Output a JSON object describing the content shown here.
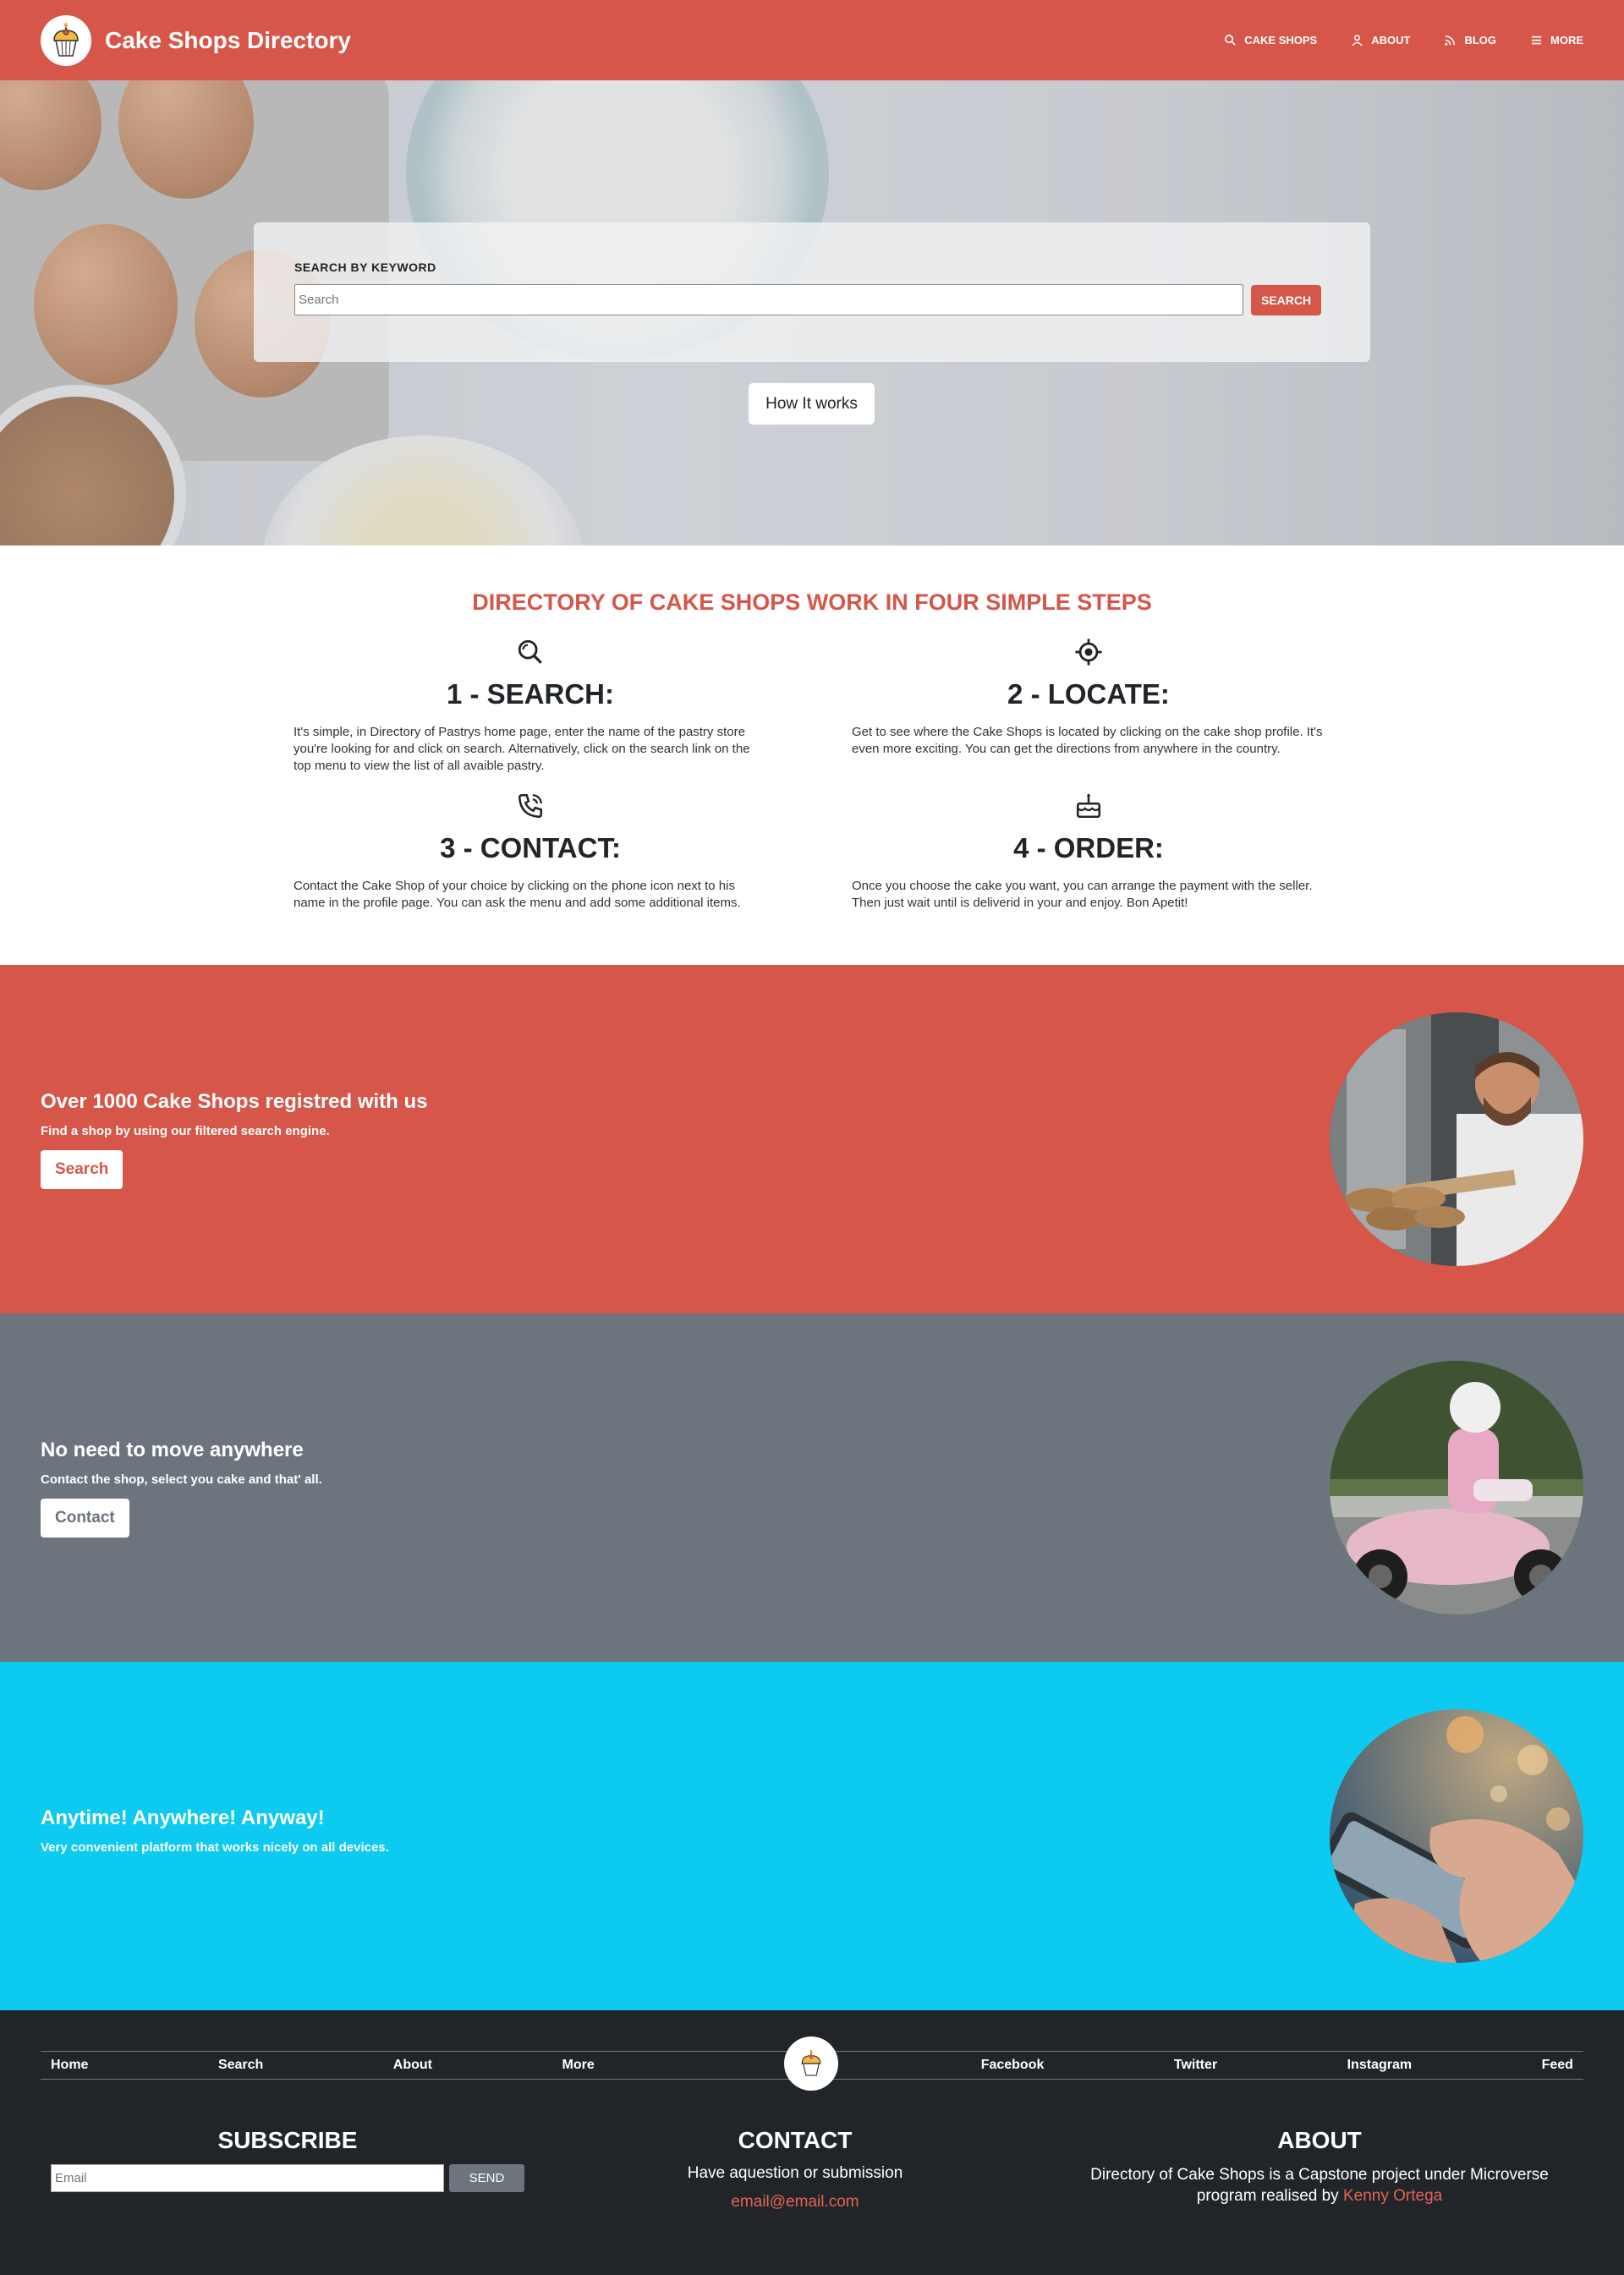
{
  "nav": {
    "brand": "Cake Shops Directory",
    "links": [
      {
        "label": "CAKE SHOPS",
        "icon": "search-icon"
      },
      {
        "label": "ABOUT",
        "icon": "user-icon"
      },
      {
        "label": "BLOG",
        "icon": "rss-icon"
      },
      {
        "label": "MORE",
        "icon": "menu-icon"
      }
    ]
  },
  "hero": {
    "search_heading": "SEARCH BY KEYWORD",
    "search_placeholder": "Search",
    "search_button": "SEARCH",
    "how_button": "How It works"
  },
  "steps": {
    "title": "DIRECTORY OF CAKE SHOPS WORK IN FOUR SIMPLE STEPS",
    "items": [
      {
        "heading": "1 - SEARCH:",
        "icon": "search-icon",
        "text": "It's simple, in Directory of Pastrys home page, enter the name of the pastry store you're looking for and click on search. Alternatively, click on the search link on the top menu to view the list of all avaible pastry."
      },
      {
        "heading": "2 - LOCATE:",
        "icon": "target-icon",
        "text": "Get to see where the Cake Shops is located by clicking on the cake shop profile. It's even more exciting. You can get the directions from anywhere in the country."
      },
      {
        "heading": "3 - CONTACT:",
        "icon": "phone-icon",
        "text": "Contact the Cake Shop of your choice by clicking on the phone icon next to his name in the profile page. You can ask the menu and add some additional items."
      },
      {
        "heading": "4 - ORDER:",
        "icon": "cake-icon",
        "text": "Once you choose the cake you want, you can arrange the payment with the seller. Then just wait until is deliverid in your and enjoy. Bon Apetit!"
      }
    ]
  },
  "features": [
    {
      "title": "Over 1000 Cake Shops registred with us",
      "subtitle": "Find a shop by using our filtered search engine.",
      "button": "Search",
      "color": "#d65649",
      "image": "baker-photo"
    },
    {
      "title": "No need to move anywhere",
      "subtitle": "Contact the shop, select you cake and that' all.",
      "button": "Contact",
      "color": "#6c757d",
      "image": "scooter-delivery-photo"
    },
    {
      "title": "Anytime! Anywhere! Anyway!",
      "subtitle": "Very convenient platform that works nicely on all devices.",
      "button": "",
      "color": "#0dcaf0",
      "image": "phone-hand-photo"
    }
  ],
  "footer": {
    "nav_left": [
      "Home",
      "Search",
      "About",
      "More"
    ],
    "nav_right": [
      "Facebook",
      "Twitter",
      "Instagram",
      "Feed"
    ],
    "subscribe": {
      "title": "SUBSCRIBE",
      "placeholder": "Email",
      "button": "SEND"
    },
    "contact": {
      "title": "CONTACT",
      "text": "Have aquestion or submission",
      "email": "email@email.com"
    },
    "about": {
      "title": "ABOUT",
      "text": "Directory of Cake Shops is a Capstone project under Microverse program realised by ",
      "author": "Kenny Ortega"
    }
  },
  "colors": {
    "brand_red": "#d65649",
    "gray": "#6c757d",
    "cyan": "#0dcaf0",
    "dark": "#212529",
    "link_red": "#e36455"
  }
}
